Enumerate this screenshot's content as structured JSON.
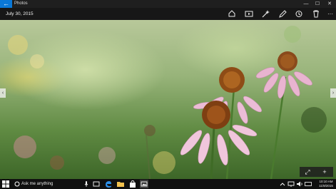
{
  "app": {
    "title": "Photos",
    "back_glyph": "←"
  },
  "window_controls": {
    "minimize": "—",
    "maximize": "☐",
    "close": "✕"
  },
  "toolbar": {
    "date": "July 30, 2015",
    "icons": [
      "share-icon",
      "slideshow-icon",
      "enhance-icon",
      "edit-icon",
      "rotate-icon",
      "delete-icon",
      "more-icon"
    ],
    "more_glyph": "···"
  },
  "photo": {
    "prev_glyph": "‹",
    "next_glyph": "›",
    "zoom_fit_glyph": "⤢",
    "zoom_in_glyph": "+"
  },
  "taskbar": {
    "search_placeholder": "Ask me anything",
    "clock": {
      "time": "10:10 AM",
      "date": "11/9/2015"
    }
  },
  "colors": {
    "accent": "#0a78d7",
    "titlebar": "#1f1f1f",
    "taskbar": "#101010"
  }
}
